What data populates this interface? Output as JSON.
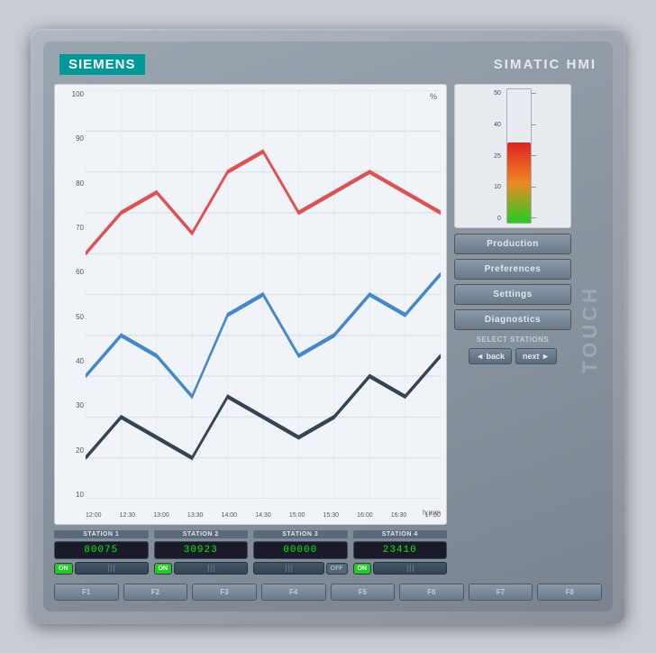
{
  "device": {
    "brand": "SIEMENS",
    "model": "SIMATIC HMI",
    "touch_label": "TOUCH"
  },
  "chart": {
    "y_labels": [
      "100",
      "90",
      "80",
      "70",
      "60",
      "50",
      "40",
      "30",
      "20",
      "10"
    ],
    "x_labels": [
      "12:00",
      "12:30",
      "13:00",
      "13:30",
      "14:00",
      "14:30",
      "15:00",
      "15:30",
      "16:00",
      "16:30",
      "17:00"
    ],
    "percent_label": "%",
    "time_label": "h:mm"
  },
  "gauge": {
    "max": 50,
    "labels": [
      "50",
      "40",
      "25",
      "10",
      "0"
    ]
  },
  "menu": {
    "buttons": [
      "Production",
      "Preferences",
      "Settings",
      "Diagnostics"
    ]
  },
  "stations": [
    {
      "label": "STATION 1",
      "value": "80075",
      "on": true
    },
    {
      "label": "STATION 2",
      "value": "30923",
      "on": true
    },
    {
      "label": "STATION 3",
      "value": "00000",
      "on": false
    },
    {
      "label": "STATION 4",
      "value": "23410",
      "on": true
    }
  ],
  "select_stations": {
    "label": "SELECT STATIONS",
    "back": "◄ back",
    "next": "next ►"
  },
  "function_keys": [
    "F1",
    "F2",
    "F3",
    "F4",
    "F5",
    "F6",
    "F7",
    "F8"
  ]
}
